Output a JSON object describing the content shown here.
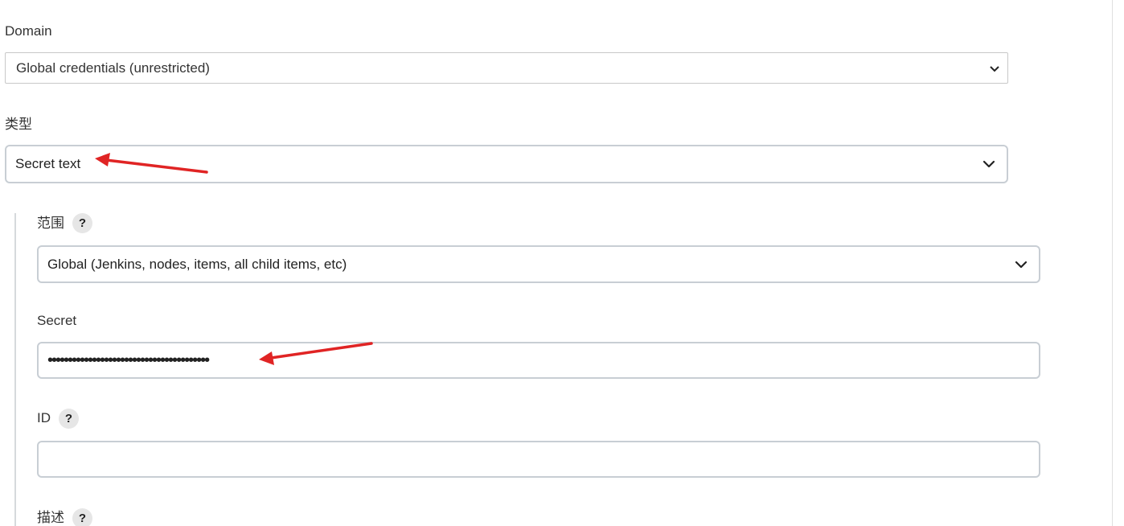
{
  "domain_section": {
    "label": "Domain",
    "selected": "Global credentials (unrestricted)"
  },
  "type_section": {
    "label": "类型",
    "selected": "Secret text"
  },
  "scope_section": {
    "label": "范围",
    "help": "?",
    "selected": "Global (Jenkins, nodes, items, all child items, etc)"
  },
  "secret_section": {
    "label": "Secret",
    "value": "••••••••••••••••••••••••••••••••••••••••"
  },
  "id_section": {
    "label": "ID",
    "help": "?",
    "value": ""
  },
  "description_section": {
    "label": "描述",
    "help": "?"
  },
  "colors": {
    "annotation_arrow": "#e02424",
    "field_border": "#c8ced4",
    "section_rule": "#d6d9dc"
  }
}
